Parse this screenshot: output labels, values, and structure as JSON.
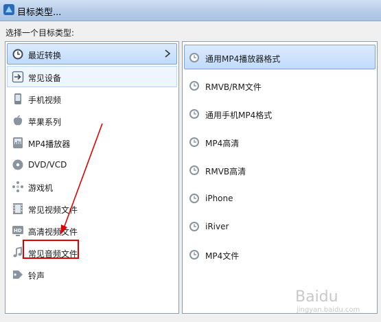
{
  "window": {
    "title": "目标类型..."
  },
  "prompt": "选择一个目标类型:",
  "left_list": [
    {
      "label": "最近转换",
      "icon": "clock-icon",
      "state": "active"
    },
    {
      "label": "常见设备",
      "icon": "arrow-box-icon",
      "state": "hover"
    },
    {
      "label": "手机视频",
      "icon": "phone-icon",
      "state": ""
    },
    {
      "label": "苹果系列",
      "icon": "apple-icon",
      "state": ""
    },
    {
      "label": "MP4播放器",
      "icon": "mp4-player-icon",
      "state": ""
    },
    {
      "label": "DVD/VCD",
      "icon": "disc-icon",
      "state": ""
    },
    {
      "label": "游戏机",
      "icon": "gamepad-icon",
      "state": ""
    },
    {
      "label": "常见视频文件",
      "icon": "film-icon",
      "state": ""
    },
    {
      "label": "高清视频文件",
      "icon": "hd-icon",
      "state": ""
    },
    {
      "label": "常见音频文件",
      "icon": "music-note-icon",
      "state": ""
    },
    {
      "label": "铃声",
      "icon": "ringtone-icon",
      "state": ""
    }
  ],
  "right_list": [
    {
      "label": "通用MP4播放器格式",
      "icon": "clock-icon",
      "state": "active"
    },
    {
      "label": "RMVB/RM文件",
      "icon": "clock-icon",
      "state": ""
    },
    {
      "label": "通用手机MP4格式",
      "icon": "clock-icon",
      "state": ""
    },
    {
      "label": "MP4高清",
      "icon": "clock-icon",
      "state": ""
    },
    {
      "label": "RMVB高清",
      "icon": "clock-icon",
      "state": ""
    },
    {
      "label": "iPhone",
      "icon": "clock-icon",
      "state": ""
    },
    {
      "label": "iRiver",
      "icon": "clock-icon",
      "state": ""
    },
    {
      "label": "MP4文件",
      "icon": "clock-icon",
      "state": ""
    }
  ],
  "colors": {
    "annotation": "#e00000",
    "selection_border": "#7da2ce"
  },
  "watermark": {
    "brand": "Baidu",
    "sub": "jingyan.baidu.com"
  }
}
